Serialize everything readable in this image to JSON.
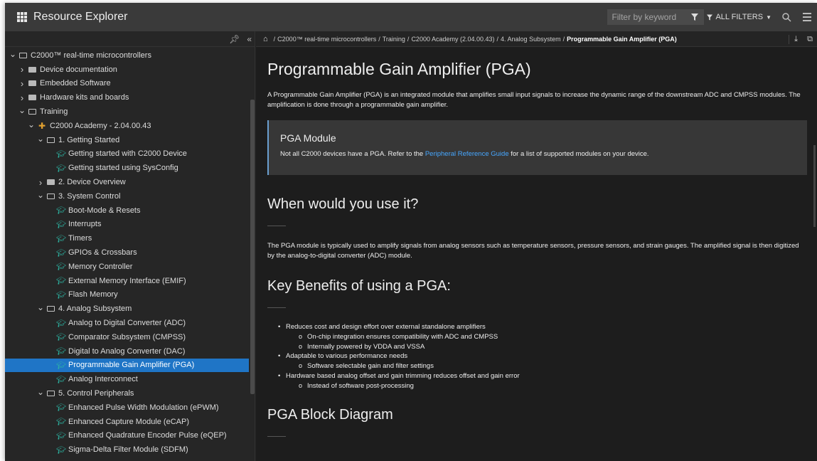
{
  "app": {
    "title": "Resource Explorer",
    "filter_placeholder": "Filter by keyword",
    "all_filters_label": "ALL FILTERS",
    "accent_color": "#1f75c6"
  },
  "icons": [
    "apps-grid-icon",
    "funnel-icon",
    "search-icon",
    "menu-icon",
    "pin-icon",
    "collapse-panel-icon",
    "home-icon",
    "download-icon",
    "external-link-icon",
    "folder-icon",
    "graduation-cap-icon"
  ],
  "tree": [
    {
      "label": "C2000™ real-time microcontrollers",
      "level": 0,
      "chev": "down",
      "icon": "folder-open"
    },
    {
      "label": "Device documentation",
      "level": 1,
      "chev": "right",
      "icon": "folder-closed"
    },
    {
      "label": "Embedded Software",
      "level": 1,
      "chev": "right",
      "icon": "folder-closed"
    },
    {
      "label": "Hardware kits and boards",
      "level": 1,
      "chev": "right",
      "icon": "folder-closed"
    },
    {
      "label": "Training",
      "level": 1,
      "chev": "down",
      "icon": "folder-open"
    },
    {
      "label": "C2000 Academy - 2.04.00.43",
      "level": 2,
      "chev": "down",
      "icon": "plus"
    },
    {
      "label": "1. Getting Started",
      "level": 3,
      "chev": "down",
      "icon": "folder-open"
    },
    {
      "label": "Getting started with C2000 Device",
      "level": 4,
      "chev": "",
      "icon": "cap"
    },
    {
      "label": "Getting started using SysConfig",
      "level": 4,
      "chev": "",
      "icon": "cap"
    },
    {
      "label": "2. Device Overview",
      "level": 3,
      "chev": "right",
      "icon": "folder-closed"
    },
    {
      "label": "3. System Control",
      "level": 3,
      "chev": "down",
      "icon": "folder-open"
    },
    {
      "label": "Boot-Mode & Resets",
      "level": 4,
      "chev": "",
      "icon": "cap"
    },
    {
      "label": "Interrupts",
      "level": 4,
      "chev": "",
      "icon": "cap"
    },
    {
      "label": "Timers",
      "level": 4,
      "chev": "",
      "icon": "cap"
    },
    {
      "label": "GPIOs & Crossbars",
      "level": 4,
      "chev": "",
      "icon": "cap"
    },
    {
      "label": "Memory Controller",
      "level": 4,
      "chev": "",
      "icon": "cap"
    },
    {
      "label": "External Memory Interface (EMIF)",
      "level": 4,
      "chev": "",
      "icon": "cap"
    },
    {
      "label": "Flash Memory",
      "level": 4,
      "chev": "",
      "icon": "cap"
    },
    {
      "label": "4. Analog Subsystem",
      "level": 3,
      "chev": "down",
      "icon": "folder-open"
    },
    {
      "label": "Analog to Digital Converter (ADC)",
      "level": 4,
      "chev": "",
      "icon": "cap"
    },
    {
      "label": "Comparator Subsystem (CMPSS)",
      "level": 4,
      "chev": "",
      "icon": "cap"
    },
    {
      "label": "Digital to Analog Converter (DAC)",
      "level": 4,
      "chev": "",
      "icon": "cap"
    },
    {
      "label": "Programmable Gain Amplifier (PGA)",
      "level": 4,
      "chev": "",
      "icon": "cap",
      "selected": true
    },
    {
      "label": "Analog Interconnect",
      "level": 4,
      "chev": "",
      "icon": "cap"
    },
    {
      "label": "5. Control Peripherals",
      "level": 3,
      "chev": "down",
      "icon": "folder-open"
    },
    {
      "label": "Enhanced Pulse Width Modulation (ePWM)",
      "level": 4,
      "chev": "",
      "icon": "cap"
    },
    {
      "label": "Enhanced Capture Module (eCAP)",
      "level": 4,
      "chev": "",
      "icon": "cap"
    },
    {
      "label": "Enhanced Quadrature Encoder Pulse (eQEP)",
      "level": 4,
      "chev": "",
      "icon": "cap"
    },
    {
      "label": "Sigma-Delta Filter Module (SDFM)",
      "level": 4,
      "chev": "",
      "icon": "cap"
    }
  ],
  "breadcrumb": {
    "items": [
      "C2000™ real-time microcontrollers",
      "Training",
      "C2000 Academy (2.04.00.43)",
      "4. Analog Subsystem"
    ],
    "current": "Programmable Gain Amplifier (PGA)"
  },
  "doc": {
    "title": "Programmable Gain Amplifier (PGA)",
    "intro": "A Programmable Gain Amplifier (PGA) is an integrated module that amplifies small input signals to increase the dynamic range of the downstream ADC and CMPSS modules. The amplification is done through a programmable gain amplifier.",
    "callout_title": "PGA Module",
    "callout_before": "Not all C2000 devices have a PGA. Refer to the ",
    "callout_link": "Peripheral Reference Guide",
    "callout_after": " for a list of supported modules on your device.",
    "h_when": "When would you use it?",
    "when_text": "The PGA module is typically used to amplify signals from analog sensors such as temperature sensors, pressure sensors, and strain gauges. The amplified signal is then digitized by the analog-to-digital converter (ADC) module.",
    "h_benefits": "Key Benefits of using a PGA:",
    "benefits": [
      {
        "text": "Reduces cost and design effort over external standalone amplifiers",
        "level": 1
      },
      {
        "text": "On-chip integration ensures compatibility with ADC and CMPSS",
        "level": 2
      },
      {
        "text": "Internally powered by VDDA and VSSA",
        "level": 2
      },
      {
        "text": "Adaptable to various performance needs",
        "level": 1
      },
      {
        "text": "Software selectable gain and filter settings",
        "level": 2
      },
      {
        "text": "Hardware based analog offset and gain trimming reduces offset and gain error",
        "level": 1
      },
      {
        "text": "Instead of software post-processing",
        "level": 2
      }
    ],
    "h_diagram": "PGA Block Diagram"
  }
}
